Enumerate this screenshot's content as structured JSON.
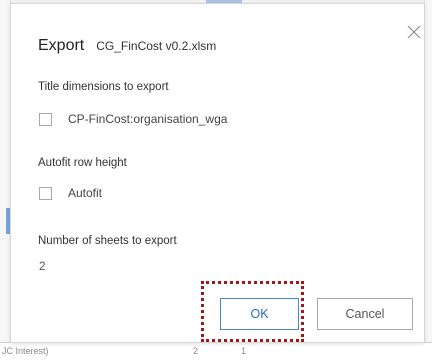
{
  "background": {
    "bottom_row_label": "JC Interest)",
    "bottom_row_value_1": "2",
    "bottom_row_value_2": "1"
  },
  "dialog": {
    "title": "Export",
    "file_name": "CG_FinCost v0.2.xlsm",
    "close_icon": "close-icon",
    "sections": {
      "title_dimensions": {
        "label": "Title dimensions to export",
        "checkbox_label": "CP-FinCost:organisation_wga",
        "checked": false
      },
      "autofit": {
        "label": "Autofit row height",
        "checkbox_label": "Autofit",
        "checked": false
      },
      "sheets": {
        "label": "Number of sheets to export",
        "value": "2"
      }
    },
    "buttons": {
      "ok": "OK",
      "cancel": "Cancel"
    }
  },
  "colors": {
    "ok_border": "#4a85c9",
    "highlight": "#a01818"
  }
}
